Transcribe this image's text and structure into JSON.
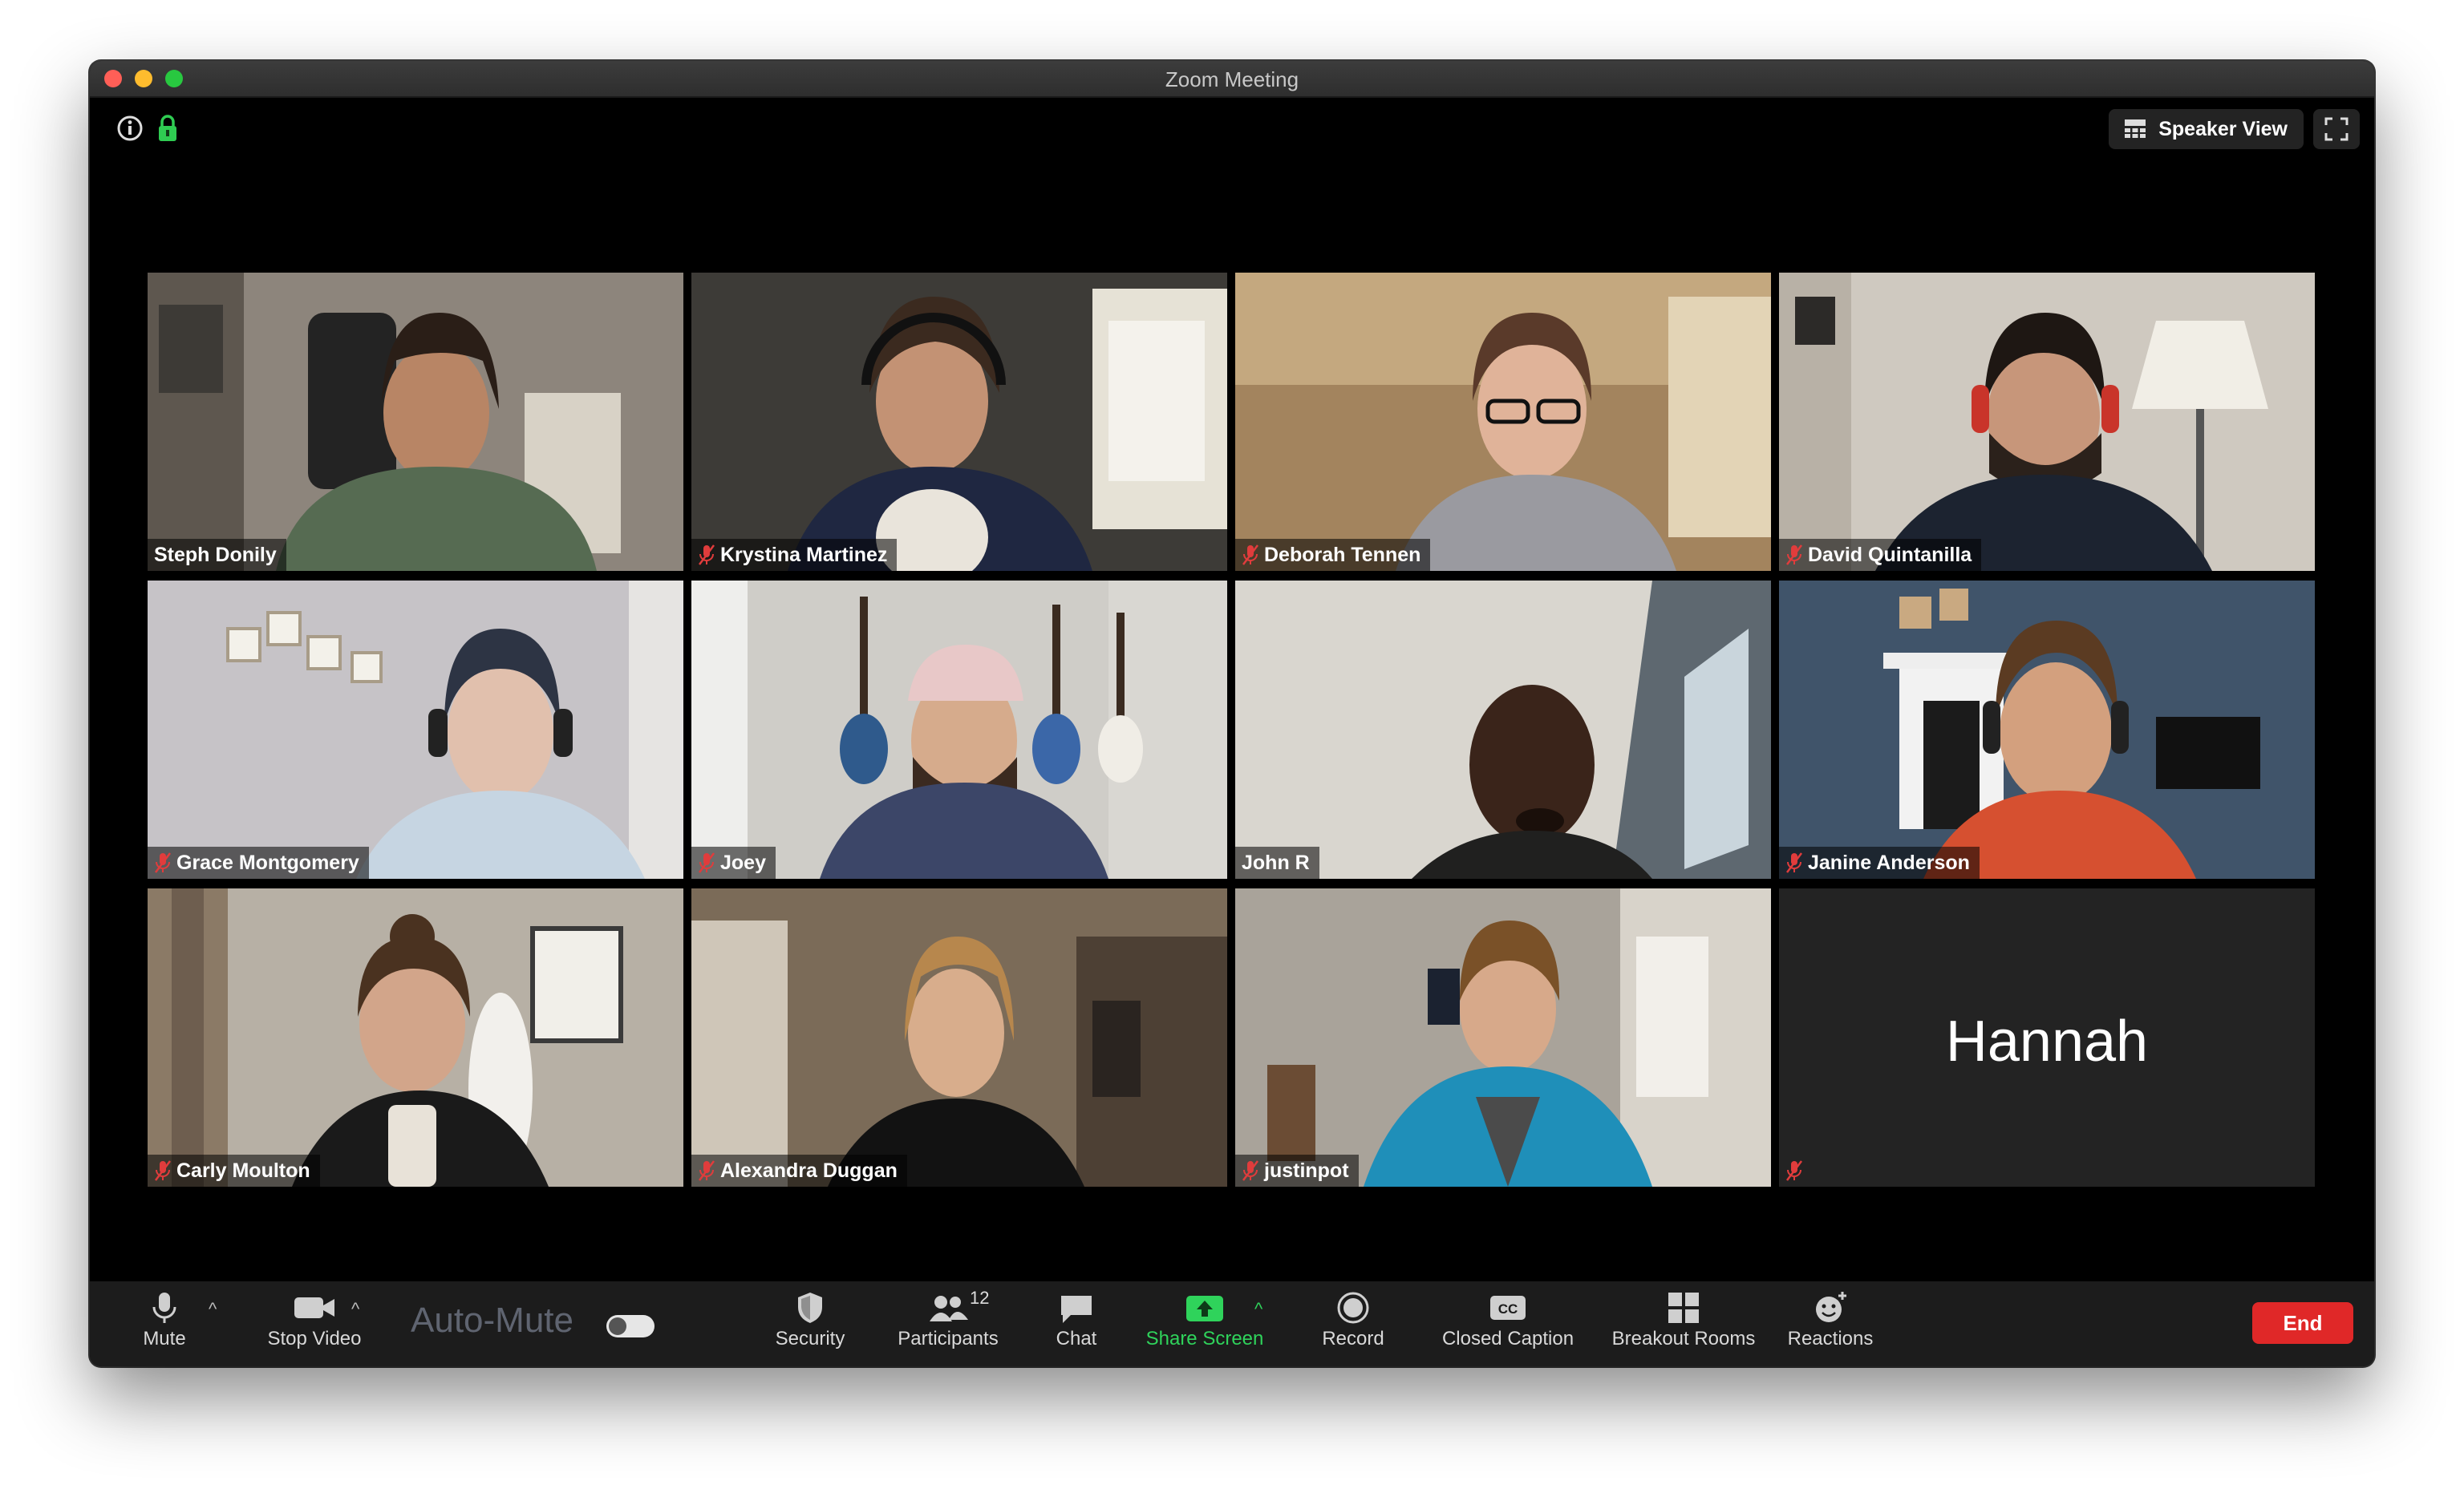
{
  "window": {
    "title": "Zoom Meeting"
  },
  "top_bar": {
    "speaker_view_label": "Speaker View"
  },
  "participants": [
    {
      "name": "Steph Donily",
      "muted": false
    },
    {
      "name": "Krystina Martinez",
      "muted": true
    },
    {
      "name": "Deborah Tennen",
      "muted": true
    },
    {
      "name": "David Quintanilla",
      "muted": true
    },
    {
      "name": "Grace Montgomery",
      "muted": true
    },
    {
      "name": "Joey",
      "muted": true
    },
    {
      "name": "John R",
      "muted": false,
      "active_speaker": true
    },
    {
      "name": "Janine Anderson",
      "muted": true
    },
    {
      "name": "Carly Moulton",
      "muted": true
    },
    {
      "name": "Alexandra Duggan",
      "muted": true
    },
    {
      "name": "justinpot",
      "muted": true
    },
    {
      "name": "Hannah",
      "muted": true,
      "video_off": true
    }
  ],
  "toolbar": {
    "mute_label": "Mute",
    "stop_video_label": "Stop Video",
    "auto_mute_label": "Auto-Mute",
    "security_label": "Security",
    "participants_label": "Participants",
    "participants_count": "12",
    "chat_label": "Chat",
    "share_screen_label": "Share Screen",
    "record_label": "Record",
    "closed_caption_label": "Closed Caption",
    "breakout_rooms_label": "Breakout Rooms",
    "reactions_label": "Reactions",
    "end_label": "End"
  },
  "colors": {
    "active_speaker_border": "#d6e96b",
    "share_screen_green": "#2fd35b",
    "end_red": "#e02828",
    "muted_red": "#e03c3c"
  },
  "icons": [
    "info-icon",
    "lock-icon",
    "grid-icon",
    "fullscreen-icon",
    "mic-muted-icon",
    "microphone-icon",
    "video-camera-icon",
    "shield-icon",
    "people-icon",
    "chat-bubble-icon",
    "share-arrow-icon",
    "record-icon",
    "cc-icon",
    "breakout-grid-icon",
    "reaction-smile-icon"
  ]
}
